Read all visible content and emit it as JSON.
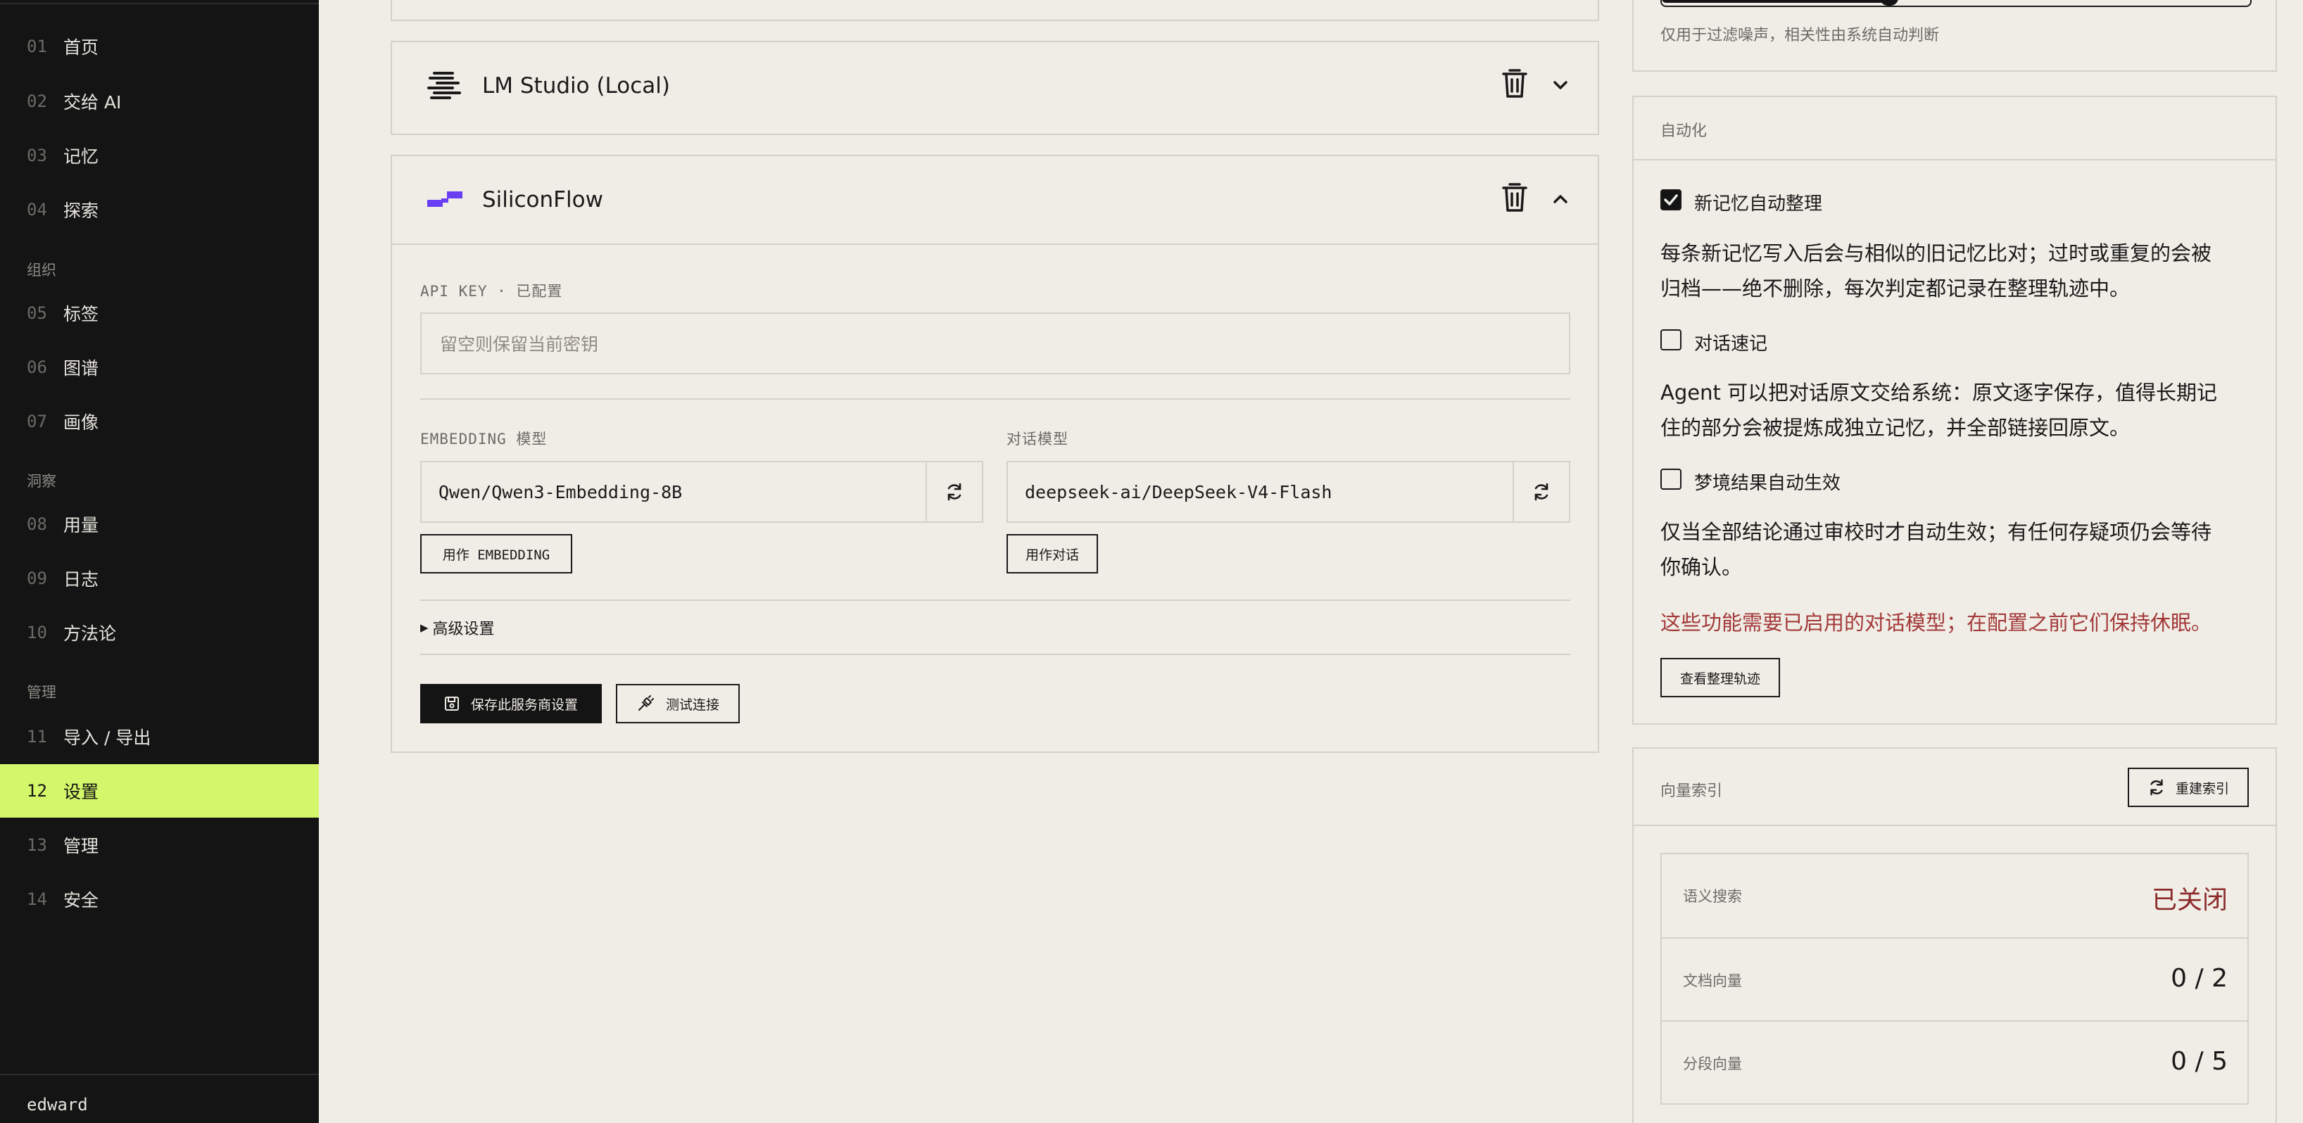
{
  "sidebar": {
    "items": [
      {
        "num": "01",
        "label": "首页"
      },
      {
        "num": "02",
        "label": "交给 AI"
      },
      {
        "num": "03",
        "label": "记忆"
      },
      {
        "num": "04",
        "label": "探索"
      },
      {
        "num": "05",
        "label": "标签"
      },
      {
        "num": "06",
        "label": "图谱"
      },
      {
        "num": "07",
        "label": "画像"
      },
      {
        "num": "08",
        "label": "用量"
      },
      {
        "num": "09",
        "label": "日志"
      },
      {
        "num": "10",
        "label": "方法论"
      },
      {
        "num": "11",
        "label": "导入 / 导出"
      },
      {
        "num": "12",
        "label": "设置"
      },
      {
        "num": "13",
        "label": "管理"
      },
      {
        "num": "14",
        "label": "安全"
      }
    ],
    "groups": [
      "组织",
      "洞察",
      "管理"
    ],
    "active": "12",
    "user": "edward"
  },
  "providers": [
    {
      "name": "LM Studio (Local)",
      "icon": "lmstudio-logo",
      "expanded": false
    },
    {
      "name": "SiliconFlow",
      "icon": "siliconflow-logo",
      "expanded": true,
      "api_key_label": "API KEY · 已配置",
      "api_key_placeholder": "留空则保留当前密钥",
      "embedding_label": "EMBEDDING 模型",
      "embedding_value": "Qwen/Qwen3-Embedding-8B",
      "embedding_button": "用作 EMBEDDING",
      "chat_label": "对话模型",
      "chat_value": "deepseek-ai/DeepSeek-V4-Flash",
      "chat_button": "用作对话",
      "advanced": "高级设置",
      "save_button": "保存此服务商设置",
      "test_button": "测试连接"
    }
  ],
  "relevance_panel": {
    "hint": "仅用于过滤噪声，相关性由系统自动判断"
  },
  "automation": {
    "title": "自动化",
    "options": [
      {
        "label": "新记忆自动整理",
        "checked": true,
        "desc_lines": [
          "每条新记忆写入后会与相似的旧记忆比对；过时或重复的会被",
          "归档——绝不删除，每次判定都记录在整理轨迹中。"
        ]
      },
      {
        "label": "对话速记",
        "checked": false,
        "desc_lines": [
          "Agent 可以把对话原文交给系统：原文逐字保存，值得长期记",
          "住的部分会被提炼成独立记忆，并全部链接回原文。"
        ]
      },
      {
        "label": "梦境结果自动生效",
        "checked": false,
        "desc_lines": [
          "仅当全部结论通过审校时才自动生效；有任何存疑项仍会等待",
          "你确认。"
        ]
      }
    ],
    "warning": "这些功能需要已启用的对话模型；在配置之前它们保持休眠。",
    "trail_button": "查看整理轨迹"
  },
  "vector_index": {
    "title": "向量索引",
    "rebuild_button": "重建索引",
    "stats": [
      {
        "key": "语义搜索",
        "value": "已关闭"
      },
      {
        "key": "文档向量",
        "value": "0 / 2"
      },
      {
        "key": "分段向量",
        "value": "0 / 5"
      }
    ]
  },
  "colors": {
    "accent": "#d4f66a",
    "sidebar_bg": "#141414",
    "page_bg": "#f0ede6",
    "warning": "#a33a3a"
  }
}
